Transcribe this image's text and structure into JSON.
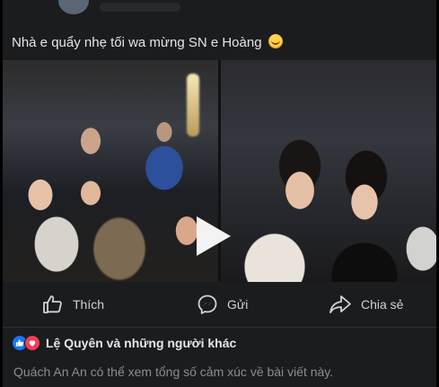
{
  "post": {
    "caption": "Nhà e quẩy nhẹ tối wa mừng SN e Hoàng",
    "caption_emoji": "smiling-face-with-hearts-icon"
  },
  "media": {
    "type": "video",
    "photos": [
      "group-photo-left",
      "two-women-photo-right"
    ]
  },
  "actions": {
    "like_label": "Thích",
    "comment_label": "Gửi",
    "share_label": "Chia sẻ"
  },
  "reactions": {
    "icons": [
      "like-icon",
      "love-icon"
    ],
    "summary": "Lệ Quyên và những người khác",
    "note": "Quách An An có thể xem tổng số cảm xúc về bài viết này."
  },
  "colors": {
    "background": "#1b1c1e",
    "text": "#e4e6eb",
    "muted": "#8a8d91",
    "like_blue": "#1877f2",
    "love_red": "#f33e58"
  }
}
